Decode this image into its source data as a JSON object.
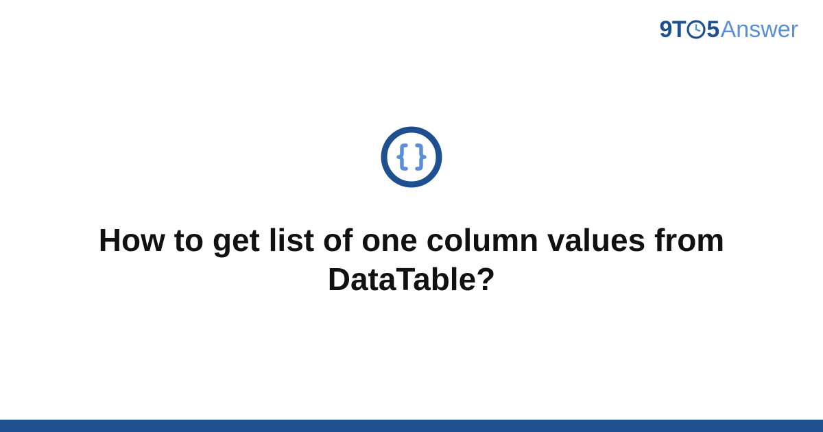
{
  "brand": {
    "part1": "9T",
    "part2": "5",
    "part3": "Answer"
  },
  "icon": {
    "name": "code-braces-circle"
  },
  "title": "How to get list of one column values from DataTable?",
  "colors": {
    "primary": "#1e4f8f",
    "secondary": "#5a8fd8"
  }
}
